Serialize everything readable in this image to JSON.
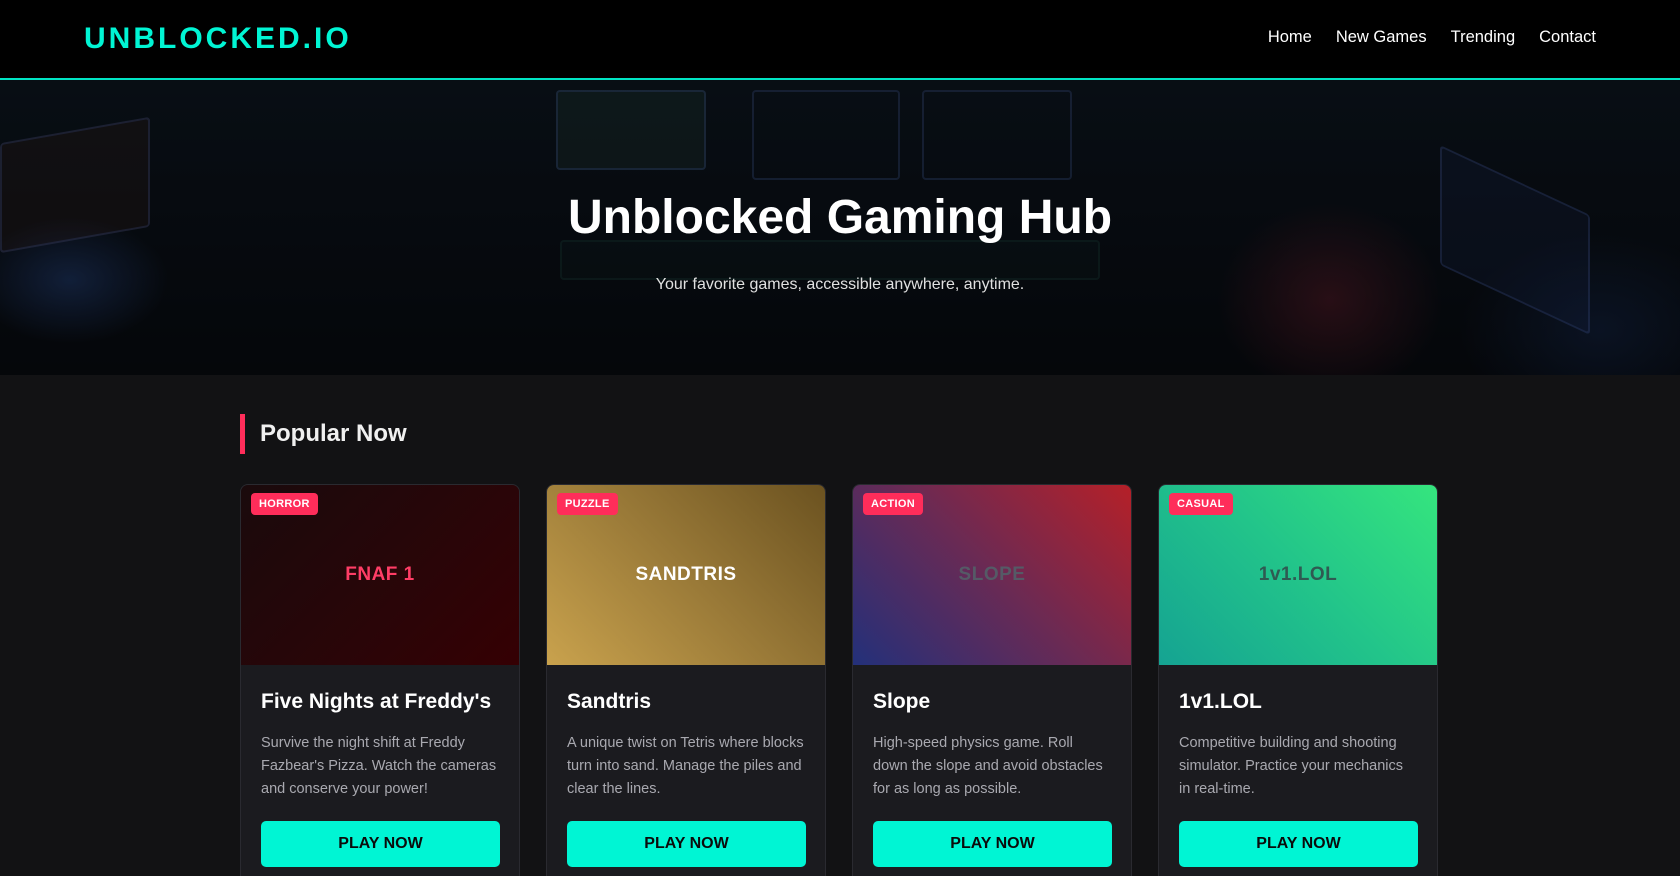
{
  "header": {
    "logo": "UNBLOCKED.IO",
    "nav": [
      "Home",
      "New Games",
      "Trending",
      "Contact"
    ]
  },
  "hero": {
    "title": "Unblocked Gaming Hub",
    "subtitle": "Your favorite games, accessible anywhere, anytime."
  },
  "section": {
    "title": "Popular Now"
  },
  "cards": [
    {
      "badge": "HORROR",
      "thumb": "FNAF 1",
      "title": "Five Nights at Freddy's",
      "desc": "Survive the night shift at Freddy Fazbear's Pizza. Watch the cameras and conserve your power!",
      "button": "PLAY NOW"
    },
    {
      "badge": "PUZZLE",
      "thumb": "SANDTRIS",
      "title": "Sandtris",
      "desc": "A unique twist on Tetris where blocks turn into sand. Manage the piles and clear the lines.",
      "button": "PLAY NOW"
    },
    {
      "badge": "ACTION",
      "thumb": "SLOPE",
      "title": "Slope",
      "desc": "High-speed physics game. Roll down the slope and avoid obstacles for as long as possible.",
      "button": "PLAY NOW"
    },
    {
      "badge": "CASUAL",
      "thumb": "1v1.LOL",
      "title": "1v1.LOL",
      "desc": "Competitive building and shooting simulator. Practice your mechanics in real-time.",
      "button": "PLAY NOW"
    }
  ],
  "colors": {
    "accent": "#00f5d4",
    "badge": "#ff2d5a",
    "background": "#121214"
  }
}
